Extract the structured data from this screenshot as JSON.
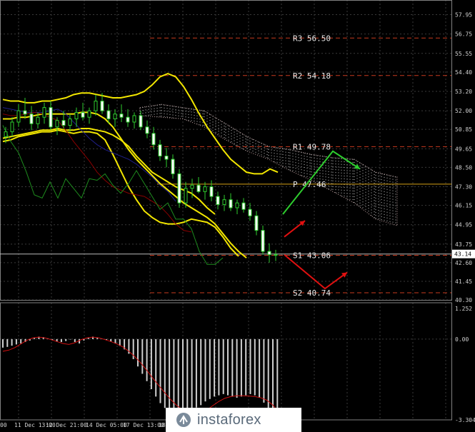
{
  "chart_data": [
    {
      "type": "candlestick",
      "title": "",
      "ylim": [
        40.3,
        58.5
      ],
      "y_ticks": [
        "57.95",
        "56.75",
        "55.55",
        "54.40",
        "53.20",
        "52.00",
        "50.85",
        "49.65",
        "48.50",
        "47.30",
        "46.15",
        "44.95",
        "43.75",
        "42.60",
        "41.45",
        "40.30"
      ],
      "current_price": "43.14",
      "x_ticks": [
        "00",
        "11 Dec 13:00",
        "12 Dec 21:00",
        "14 Dec 05:00",
        "17 Dec 13:00",
        "18 Dec"
      ],
      "levels": [
        {
          "label": "R3 56.50",
          "value": 56.5,
          "style": "dashed",
          "color": "#c83a1e"
        },
        {
          "label": "R2 54.18",
          "value": 54.18,
          "style": "dashed",
          "color": "#c83a1e"
        },
        {
          "label": "R1 49.78",
          "value": 49.78,
          "style": "dashed",
          "color": "#c83a1e"
        },
        {
          "label": "P 47.46",
          "value": 47.46,
          "style": "solid",
          "color": "#d4a017"
        },
        {
          "label": "S1 43.06",
          "value": 43.06,
          "style": "dashed",
          "color": "#c83a1e"
        },
        {
          "label": "S2 40.74",
          "value": 40.74,
          "style": "dashed",
          "color": "#c83a1e"
        }
      ],
      "series": [
        {
          "name": "",
          "type": "candles",
          "values": [
            [
              50.4,
              51.0,
              50.0,
              50.7
            ],
            [
              50.7,
              51.6,
              50.4,
              51.3
            ],
            [
              51.3,
              52.4,
              51.0,
              52.0
            ],
            [
              52.0,
              52.8,
              51.5,
              51.8
            ],
            [
              51.8,
              52.3,
              50.8,
              51.2
            ],
            [
              51.2,
              51.9,
              50.9,
              51.6
            ],
            [
              51.6,
              52.5,
              51.2,
              52.2
            ],
            [
              52.2,
              52.6,
              50.8,
              51.0
            ],
            [
              51.0,
              51.6,
              50.5,
              51.4
            ],
            [
              51.4,
              52.0,
              50.9,
              51.1
            ],
            [
              51.1,
              51.8,
              50.7,
              51.5
            ],
            [
              51.5,
              52.2,
              51.0,
              51.9
            ],
            [
              51.9,
              52.5,
              51.4,
              51.6
            ],
            [
              51.6,
              52.2,
              51.2,
              52.0
            ],
            [
              52.0,
              53.0,
              51.7,
              52.6
            ],
            [
              52.6,
              53.1,
              51.8,
              52.0
            ],
            [
              52.0,
              52.4,
              51.2,
              51.5
            ],
            [
              51.5,
              52.1,
              51.0,
              51.8
            ],
            [
              51.8,
              52.4,
              51.3,
              51.6
            ],
            [
              51.6,
              52.1,
              51.0,
              51.3
            ],
            [
              51.3,
              51.9,
              50.9,
              51.7
            ],
            [
              51.7,
              52.0,
              50.8,
              51.0
            ],
            [
              51.0,
              51.4,
              50.3,
              50.6
            ],
            [
              50.6,
              51.0,
              49.6,
              49.9
            ],
            [
              49.9,
              50.2,
              48.9,
              49.2
            ],
            [
              49.2,
              49.7,
              48.5,
              49.0
            ],
            [
              49.0,
              49.3,
              47.8,
              48.1
            ],
            [
              48.1,
              48.4,
              46.0,
              46.3
            ],
            [
              46.3,
              47.6,
              46.0,
              47.2
            ],
            [
              47.2,
              47.8,
              46.6,
              47.4
            ],
            [
              47.4,
              47.9,
              46.9,
              47.0
            ],
            [
              47.0,
              47.6,
              46.5,
              47.3
            ],
            [
              47.3,
              47.7,
              46.4,
              46.7
            ],
            [
              46.7,
              47.0,
              45.9,
              46.2
            ],
            [
              46.2,
              46.8,
              45.8,
              46.5
            ],
            [
              46.5,
              46.9,
              45.8,
              46.0
            ],
            [
              46.0,
              46.5,
              45.6,
              46.3
            ],
            [
              46.3,
              46.6,
              45.7,
              45.9
            ],
            [
              45.9,
              46.3,
              45.2,
              45.5
            ],
            [
              45.5,
              45.8,
              44.3,
              44.6
            ],
            [
              44.6,
              44.9,
              43.1,
              43.3
            ],
            [
              43.3,
              43.8,
              42.6,
              43.1
            ],
            [
              43.1,
              43.4,
              42.7,
              43.1
            ]
          ]
        },
        {
          "name": "",
          "type": "line",
          "color": "#f2e600",
          "values": [
            52.7,
            52.6,
            52.6,
            52.5,
            52.5,
            52.6,
            52.6,
            52.7,
            52.8,
            53.0,
            53.1,
            53.1,
            53.0,
            52.9,
            52.8,
            52.8,
            52.9,
            53.0,
            53.2,
            53.6,
            54.1,
            54.3,
            54.1,
            53.5,
            52.7,
            51.8,
            51.0,
            50.3,
            49.6,
            49.0,
            48.6,
            48.2,
            48.1,
            48.1,
            48.4,
            48.2
          ]
        },
        {
          "name": "",
          "type": "line",
          "color": "#f2e600",
          "values": [
            50.3,
            50.4,
            50.5,
            50.6,
            50.7,
            50.8,
            50.8,
            50.9,
            50.8,
            50.8,
            50.9,
            50.9,
            50.8,
            50.7,
            50.5,
            50.2,
            49.8,
            49.2,
            48.7,
            48.2,
            47.9,
            47.6,
            47.3,
            47.1,
            46.9,
            46.5,
            46.0,
            45.6
          ]
        },
        {
          "name": "",
          "type": "line",
          "color": "#f2e600",
          "values": [
            51.5,
            51.5,
            51.6,
            51.6,
            51.7,
            51.8,
            51.8,
            51.8,
            51.8,
            51.8,
            51.9,
            51.9,
            51.8,
            51.5,
            51.0,
            50.3,
            49.6,
            49.0,
            48.5,
            48.0,
            47.5,
            47.1,
            46.7,
            46.3,
            46.0,
            45.7,
            45.4,
            45.0,
            44.4,
            43.8,
            43.3,
            42.9
          ]
        },
        {
          "name": "",
          "type": "line",
          "color": "#f2e600",
          "values": [
            50.1,
            50.2,
            50.4,
            50.5,
            50.6,
            50.7,
            50.7,
            50.8,
            50.7,
            50.6,
            50.7,
            50.7,
            50.6,
            50.2,
            49.3,
            48.3,
            47.3,
            46.5,
            45.8,
            45.4,
            45.1,
            45.0,
            45.0,
            45.1,
            45.3,
            45.2,
            45.1,
            44.8,
            44.2,
            43.5,
            43.0
          ]
        },
        {
          "name": "",
          "type": "line",
          "color": "#1f1f8a",
          "values": [
            52.2,
            52.1,
            52.0,
            51.9,
            51.9,
            51.9,
            52.0,
            52.1,
            51.8,
            51.3,
            50.8,
            50.3,
            49.9,
            49.6,
            49.4,
            49.2,
            49.0,
            48.7,
            48.3,
            47.9,
            47.4,
            47.0,
            46.4
          ]
        },
        {
          "name": "",
          "type": "line",
          "color": "#8b0000",
          "values": [
            51.8,
            51.7,
            51.7,
            51.8,
            51.9,
            51.8,
            51.6,
            51.4,
            50.8,
            50.1,
            49.5,
            48.9,
            48.2,
            47.7,
            47.3,
            47.1,
            46.9,
            46.8,
            46.7,
            46.4,
            46.1,
            45.6,
            45.0,
            44.6,
            44.5
          ]
        },
        {
          "name": "",
          "type": "line",
          "color": "#1e8c1e",
          "values": [
            51.1,
            50.1,
            49.4,
            48.2,
            46.8,
            46.6,
            47.6,
            46.6,
            47.8,
            47.2,
            46.6,
            47.8,
            47.7,
            48.1,
            47.4,
            46.9,
            47.5,
            48.3,
            47.5,
            46.7,
            45.9,
            46.3,
            45.3,
            45.3,
            44.7,
            43.3,
            42.5,
            42.5,
            42.9
          ]
        },
        {
          "name": "",
          "type": "cloud",
          "color": "#c0a0a0",
          "upper": [
            52.2,
            52.4,
            52.2,
            52.0,
            51.2,
            50.4,
            49.8,
            49.6,
            49.3,
            49.1,
            49.0,
            48.2,
            47.9
          ],
          "lower": [
            51.7,
            51.6,
            51.5,
            51.0,
            50.2,
            49.5,
            49.0,
            48.3,
            47.7,
            47.0,
            46.3,
            45.3,
            44.9
          ]
        }
      ]
    },
    {
      "type": "bar",
      "title": "",
      "ylim": [
        -3.304,
        1.252
      ],
      "y_ticks": [
        "1.252",
        "0.00",
        "-3.304"
      ],
      "series": [
        {
          "name": "",
          "type": "histogram",
          "values": [
            -0.35,
            -0.32,
            -0.27,
            -0.22,
            -0.18,
            -0.12,
            -0.06,
            0.04,
            0.1,
            0.08,
            0.03,
            -0.05,
            -0.1,
            -0.12,
            -0.08,
            -0.02,
            -0.12,
            -0.18,
            -0.06,
            0.06,
            0.1,
            0.07,
            0.02,
            -0.04,
            -0.1,
            -0.18,
            -0.28,
            -0.42,
            -0.6,
            -0.82,
            -1.12,
            -1.42,
            -1.72,
            -2.05,
            -2.35,
            -2.62,
            -2.82,
            -3.0,
            -3.18,
            -3.25,
            -3.2,
            -3.1,
            -2.95,
            -2.8,
            -2.7,
            -2.55,
            -2.45,
            -2.35,
            -2.3,
            -2.25,
            -2.3,
            -2.35,
            -2.4,
            -2.35,
            -2.3,
            -2.25,
            -2.3,
            -2.4,
            -2.6,
            -2.85,
            -3.1,
            -3.3
          ]
        },
        {
          "name": "",
          "type": "line",
          "color": "#d11010",
          "values": [
            -0.5,
            -0.45,
            -0.35,
            -0.2,
            -0.05,
            0.05,
            0.08,
            0.05,
            -0.02,
            -0.1,
            -0.18,
            -0.22,
            -0.15,
            -0.03,
            0.05,
            0.08,
            0.05,
            -0.02,
            -0.1,
            -0.2,
            -0.32,
            -0.5,
            -0.72,
            -0.98,
            -1.28,
            -1.6,
            -1.9,
            -2.2,
            -2.48,
            -2.72,
            -2.9,
            -3.02,
            -3.1,
            -3.05,
            -2.9,
            -2.72,
            -2.55,
            -2.42,
            -2.35,
            -2.32,
            -2.32,
            -2.33,
            -2.35,
            -2.4,
            -2.5,
            -2.7,
            -3.0
          ]
        }
      ]
    }
  ],
  "watermark": {
    "brand": "instaforex",
    "icon": "instaforex-logo-icon"
  }
}
